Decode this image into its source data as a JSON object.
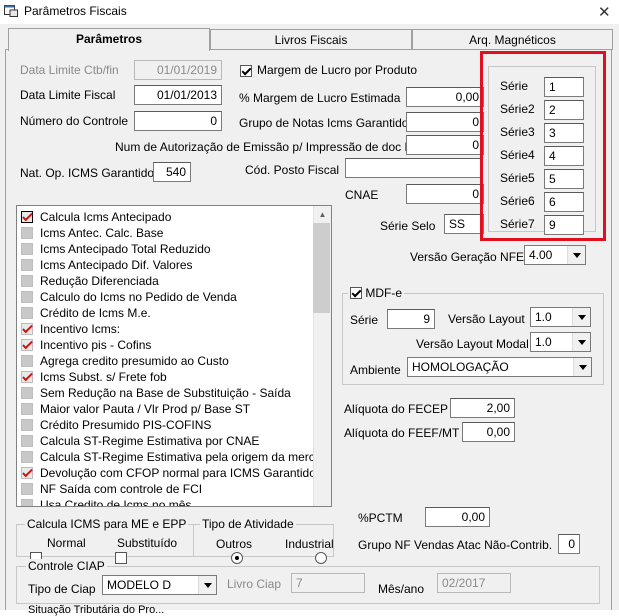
{
  "window": {
    "title": "Parâmetros Fiscais"
  },
  "tabs": [
    {
      "label": "Parâmetros",
      "active": true
    },
    {
      "label": "Livros Fiscais",
      "active": false
    },
    {
      "label": "Arq. Magnéticos",
      "active": false
    }
  ],
  "fields": {
    "data_limite_ctb_label": "Data Limite Ctb/fin",
    "data_limite_ctb_value": "01/01/2019",
    "data_limite_fiscal_label": "Data Limite Fiscal",
    "data_limite_fiscal_value": "01/01/2013",
    "numero_controle_label": "Número do Controle",
    "numero_controle_value": "0",
    "margem_lucro_produto_label": "Margem de Lucro por Produto",
    "pct_margem_label": "% Margem de Lucro Estimada",
    "pct_margem_value": "0,00",
    "grupo_notas_label": "Grupo de Notas Icms Garantido",
    "grupo_notas_value": "0",
    "num_autorizacao_label": "Num de Autorização de Emissão p/ Impressão de doc Fiscais",
    "num_autorizacao_value": "0",
    "nat_op_label": "Nat. Op. ICMS Garantido",
    "nat_op_value": "540",
    "cod_posto_label": "Cód. Posto Fiscal",
    "cod_posto_value": "",
    "cnae_label": "CNAE",
    "cnae_value": "0",
    "serie_selo_label": "Série Selo",
    "serie_selo_value": "SS",
    "versao_geracao_label": "Versão Geração NFE",
    "versao_geracao_value": "4.00"
  },
  "series": [
    {
      "label": "Série",
      "value": "1"
    },
    {
      "label": "Série2",
      "value": "2"
    },
    {
      "label": "Série3",
      "value": "3"
    },
    {
      "label": "Série4",
      "value": "4"
    },
    {
      "label": "Série5",
      "value": "5"
    },
    {
      "label": "Série6",
      "value": "6"
    },
    {
      "label": "Série7",
      "value": "9"
    }
  ],
  "options_list": [
    {
      "label": "Calcula Icms Antecipado",
      "checked": true
    },
    {
      "label": "Icms Antec. Calc. Base",
      "checked": false
    },
    {
      "label": "Icms Antecipado Total Reduzido",
      "checked": false
    },
    {
      "label": "Icms Antecipado Dif. Valores",
      "checked": false
    },
    {
      "label": "Redução Diferenciada",
      "checked": false
    },
    {
      "label": "Calculo do Icms no Pedido de Venda",
      "checked": false
    },
    {
      "label": "Crédito de Icms M.e.",
      "checked": false
    },
    {
      "label": "Incentivo Icms:",
      "checked": true
    },
    {
      "label": "Incentivo pis - Cofins",
      "checked": true
    },
    {
      "label": "Agrega credito presumido ao Custo",
      "checked": false
    },
    {
      "label": "Icms Subst. s/ Frete fob",
      "checked": true
    },
    {
      "label": "Sem Redução na Base de Substituição - Saída",
      "checked": false
    },
    {
      "label": "Maior valor Pauta / Vlr Prod p/ Base ST",
      "checked": false
    },
    {
      "label": "Crédito Presumido PIS-COFINS",
      "checked": false
    },
    {
      "label": "Calcula ST-Regime Estimativa por CNAE",
      "checked": false
    },
    {
      "label": "Calcula ST-Regime Estimativa pela origem da mercadoria",
      "checked": false
    },
    {
      "label": "Devolução com CFOP normal para ICMS Garantido",
      "checked": true
    },
    {
      "label": "NF Saída com controle de FCI",
      "checked": false
    },
    {
      "label": "Usa Credito de Icms no mês",
      "checked": false
    }
  ],
  "mdfe": {
    "title": "MDF-e",
    "serie_label": "Série",
    "serie_value": "9",
    "versao_layout_label": "Versão Layout",
    "versao_layout_value": "1.0",
    "versao_modal_label": "Versão Layout Modal",
    "versao_modal_value": "1.0",
    "ambiente_label": "Ambiente",
    "ambiente_value": "HOMOLOGAÇÃO"
  },
  "aliquotas": {
    "fecep_label": "Alíquota do FECEP",
    "fecep_value": "2,00",
    "feef_label": "Alíquota do FEEF/MT",
    "feef_value": "0,00",
    "pctm_label": "%PCTM",
    "pctm_value": "0,00",
    "grupo_nf_label": "Grupo NF Vendas Atac Não-Contrib.",
    "grupo_nf_value": "0"
  },
  "calc_icms": {
    "title": "Calcula ICMS para ME e EPP",
    "normal_label": "Normal",
    "substituido_label": "Substituído"
  },
  "tipo_atividade": {
    "title": "Tipo de Atividade",
    "outros_label": "Outros",
    "industrial_label": "Industrial"
  },
  "ciap": {
    "title": "Controle CIAP",
    "tipo_label": "Tipo de Ciap",
    "tipo_value": "MODELO D",
    "livro_label": "Livro Ciap",
    "livro_value": "7",
    "mes_label": "Mês/ano",
    "mes_value": "02/2017"
  },
  "bottom_cut_label": "Situação Tributária do Pro..."
}
